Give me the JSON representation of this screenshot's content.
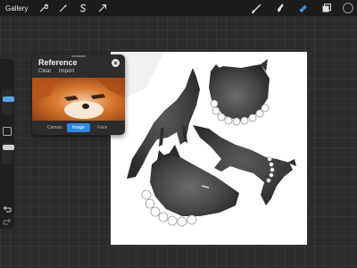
{
  "topbar": {
    "gallery_label": "Gallery",
    "left_icons": [
      "wrench-icon",
      "magic-wand-icon",
      "selection-s-icon",
      "transform-arrow-icon"
    ],
    "right_icons": [
      "brush-icon",
      "smudge-icon",
      "eraser-icon",
      "layers-icon"
    ],
    "active_tool": "eraser",
    "accent_color": "#2f86e8"
  },
  "sidebar": {
    "size_slider_level": 0.85,
    "opacity_slider_level": 0.6,
    "icons": [
      "modify-square-icon",
      "undo-arrow-icon",
      "redo-arrow-icon"
    ]
  },
  "reference": {
    "title": "Reference",
    "links": [
      "Clear",
      "Import"
    ],
    "tabs": [
      "Canvas",
      "Image",
      "Face"
    ],
    "active_tab": "Image"
  },
  "canvas": {
    "background": "#ffffff",
    "subjects": [
      "standing-fox",
      "fox-head-with-pearl-collar",
      "leaping-fox-with-pearl-necklace",
      "fox-head-profile-with-pearl-collar"
    ]
  }
}
